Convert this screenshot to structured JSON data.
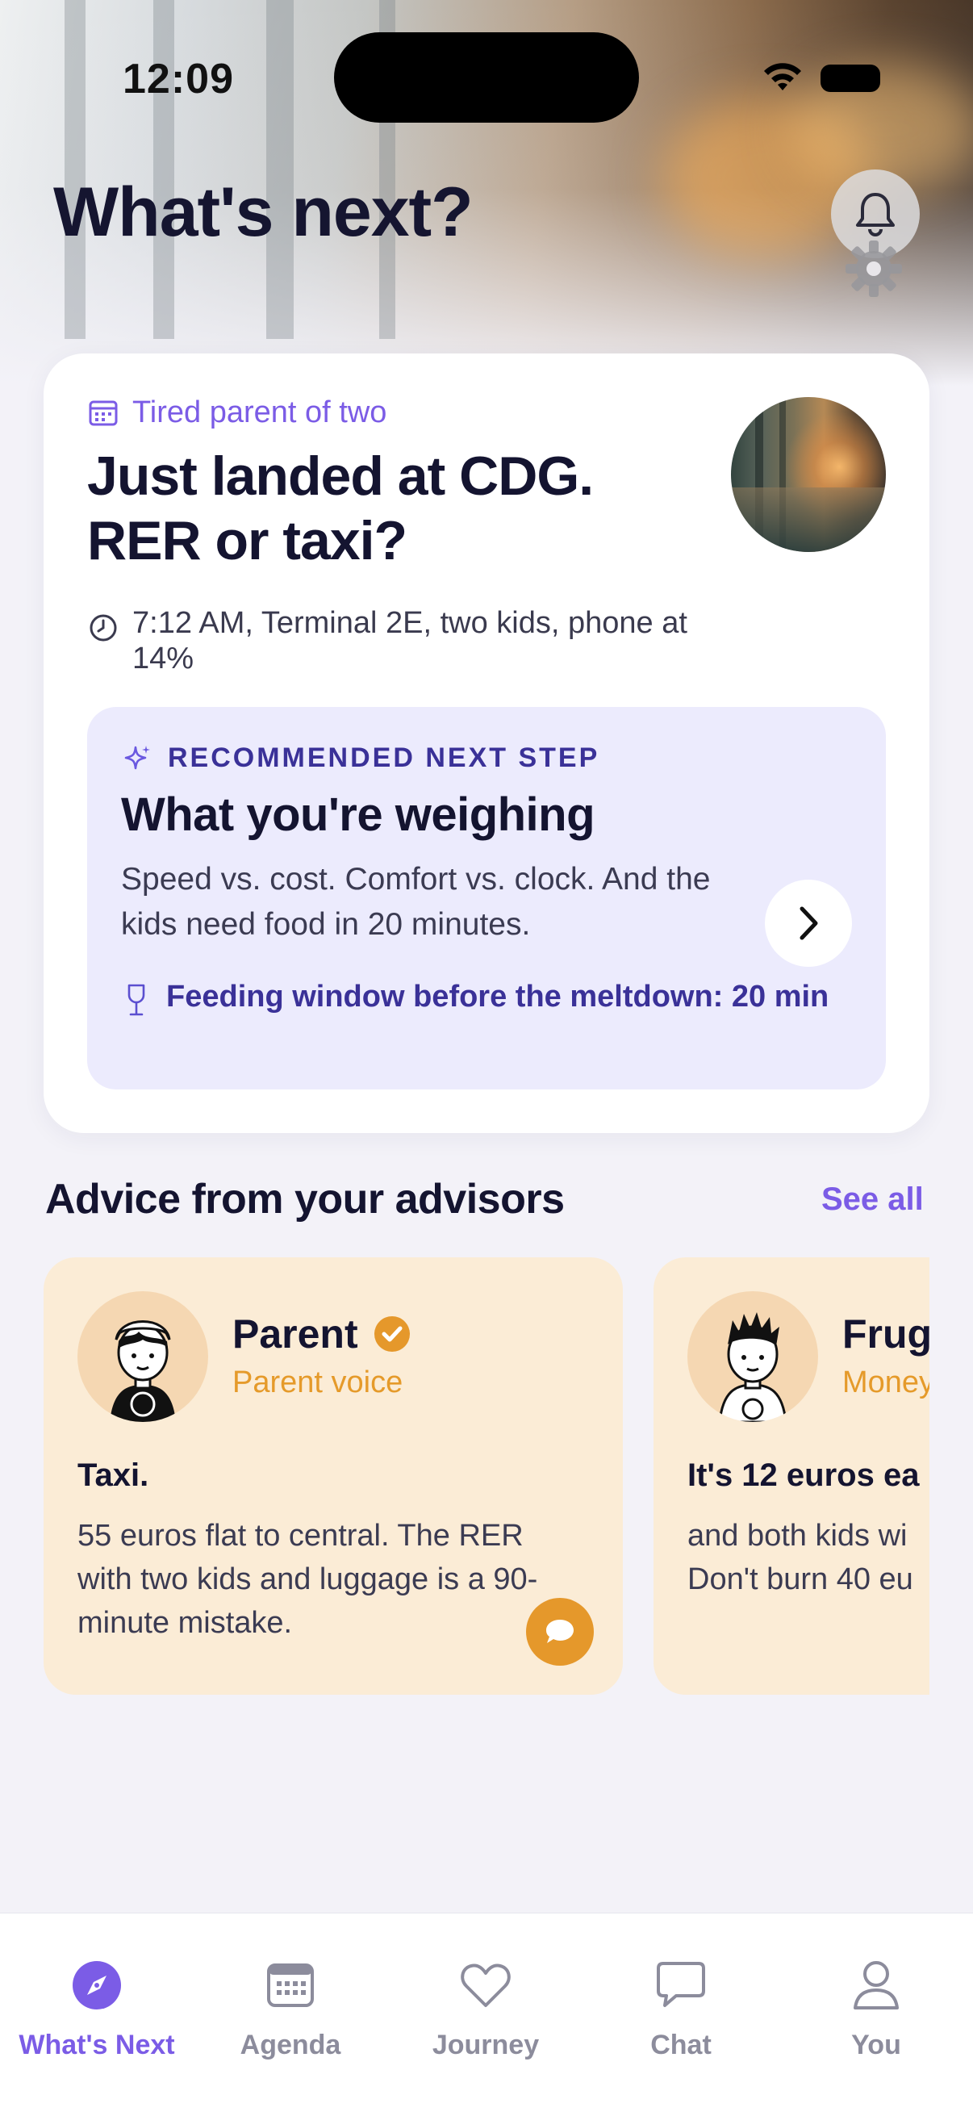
{
  "status_bar": {
    "time": "12:09"
  },
  "header": {
    "title": "What's next?"
  },
  "scenario": {
    "persona": "Tired parent of two",
    "headline": "Just landed at CDG. RER or taxi?",
    "meta": "7:12 AM, Terminal 2E, two kids, phone at 14%"
  },
  "recommendation": {
    "label": "RECOMMENDED NEXT STEP",
    "title": "What you're weighing",
    "body": "Speed vs. cost. Comfort vs. clock. And the kids need food in 20 minutes.",
    "footnote": "Feeding window before the meltdown: 20 min"
  },
  "advisors": {
    "section_title": "Advice from your advisors",
    "see_all": "See all",
    "cards": [
      {
        "name": "Parent",
        "role": "Parent voice",
        "quote": "Taxi.",
        "body": "55 euros flat to central. The RER with two kids and luggage is a 90-minute mistake."
      },
      {
        "name": "Frug",
        "role": "Money",
        "quote": "It's 12 euros ea",
        "body": "and both kids wi Don't burn 40 eu"
      }
    ]
  },
  "tabs": [
    {
      "label": "What's Next",
      "icon": "compass-icon"
    },
    {
      "label": "Agenda",
      "icon": "calendar-icon"
    },
    {
      "label": "Journey",
      "icon": "heart-icon"
    },
    {
      "label": "Chat",
      "icon": "chat-bubble-icon"
    },
    {
      "label": "You",
      "icon": "person-icon"
    }
  ],
  "colors": {
    "accent": "#7b5ce6",
    "accent_dark": "#3a3198",
    "recommend_bg": "#ecebfd",
    "advisor_bg": "#fbecd6",
    "advisor_accent": "#e5982b"
  }
}
